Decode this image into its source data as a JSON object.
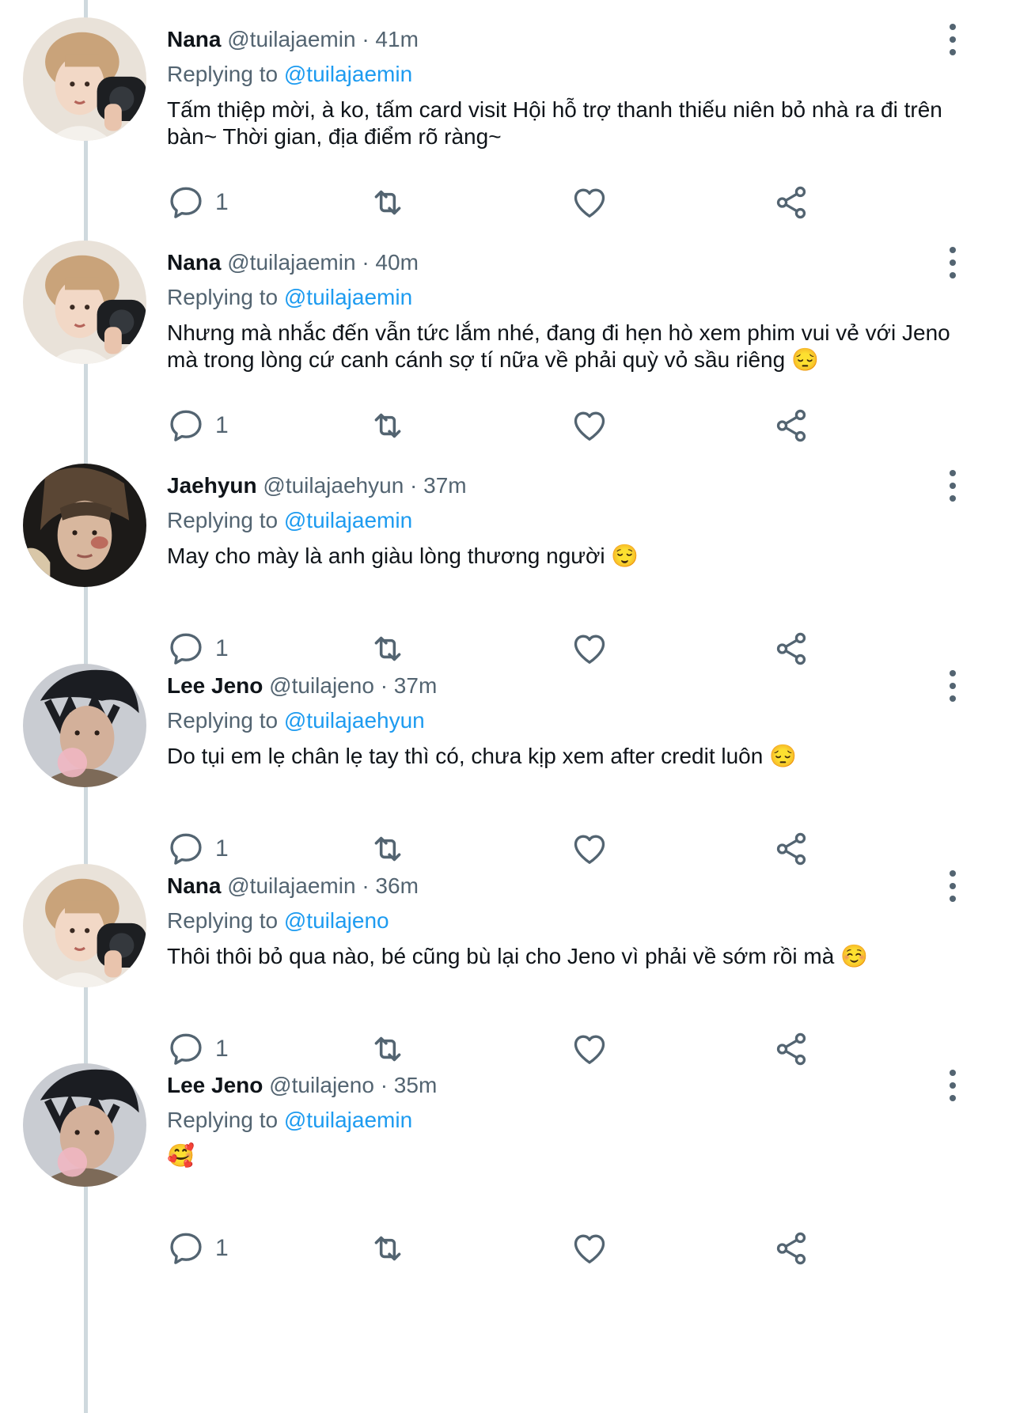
{
  "tweets": [
    {
      "name": "Nana",
      "handle": "@tuilajaemin",
      "sep": "·",
      "time": "41m",
      "replying_label": "Replying to",
      "replying_to": "@tuilajaemin",
      "text": "Tấm thiệp mời, à ko, tấm card visit Hội hỗ trợ thanh thiếu niên bỏ nhà ra đi trên bàn~ Thời gian, địa điểm rõ ràng~",
      "reply_count": "1",
      "avatar": "nana"
    },
    {
      "name": "Nana",
      "handle": "@tuilajaemin",
      "sep": "·",
      "time": "40m",
      "replying_label": "Replying to",
      "replying_to": "@tuilajaemin",
      "text": "Nhưng mà nhắc đến vẫn tức lắm nhé, đang đi hẹn hò xem phim vui vẻ với Jeno mà trong lòng cứ canh cánh sợ tí nữa về phải quỳ vỏ sầu riêng 😔",
      "reply_count": "1",
      "avatar": "nana"
    },
    {
      "name": "Jaehyun",
      "handle": "@tuilajaehyun",
      "sep": "·",
      "time": "37m",
      "replying_label": "Replying to",
      "replying_to": "@tuilajaemin",
      "text": "May cho mày là anh giàu lòng thương người 😌",
      "reply_count": "1",
      "avatar": "jaehyun"
    },
    {
      "name": "Lee Jeno",
      "handle": "@tuilajeno",
      "sep": "·",
      "time": "37m",
      "replying_label": "Replying to",
      "replying_to": "@tuilajaehyun",
      "text": "Do tụi em lẹ chân lẹ tay thì có, chưa kịp xem after credit luôn 😔",
      "reply_count": "1",
      "avatar": "jeno"
    },
    {
      "name": "Nana",
      "handle": "@tuilajaemin",
      "sep": "·",
      "time": "36m",
      "replying_label": "Replying to",
      "replying_to": "@tuilajeno",
      "text": "Thôi thôi bỏ qua nào, bé cũng bù lại cho Jeno vì phải về sớm rồi mà ☺️",
      "reply_count": "1",
      "avatar": "nana"
    },
    {
      "name": "Lee Jeno",
      "handle": "@tuilajeno",
      "sep": "·",
      "time": "35m",
      "replying_label": "Replying to",
      "replying_to": "@tuilajaemin",
      "text": "🥰",
      "reply_count": "1",
      "avatar": "jeno"
    }
  ],
  "colors": {
    "link": "#1d9bf0",
    "muted": "#536471",
    "text": "#0f1419",
    "thread_line": "#cfd9de"
  },
  "icons": [
    "reply-icon",
    "retweet-icon",
    "like-icon",
    "share-icon",
    "more-icon"
  ]
}
